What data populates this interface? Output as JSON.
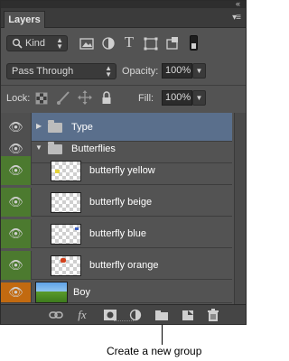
{
  "panel": {
    "tab_label": "Layers",
    "collapse_icon": "double-chevron-icon",
    "menu_icon": "panel-menu-icon"
  },
  "filter": {
    "kind_label": "Kind",
    "icons": [
      "pixel-layer-filter-icon",
      "adjustment-filter-icon",
      "type-filter-icon",
      "shape-filter-icon",
      "smart-object-filter-icon",
      "filter-toggle-icon"
    ]
  },
  "blend": {
    "mode": "Pass Through",
    "opacity_label": "Opacity:",
    "opacity_value": "100%"
  },
  "lock": {
    "label": "Lock:",
    "icons": [
      "lock-transparent-icon",
      "lock-image-icon",
      "lock-position-icon",
      "lock-all-icon"
    ],
    "fill_label": "Fill:",
    "fill_value": "100%"
  },
  "layers": [
    {
      "name": "Type",
      "kind": "group",
      "expanded": false,
      "visible": true,
      "selected": true
    },
    {
      "name": "Butterflies",
      "kind": "group",
      "expanded": true,
      "visible": true,
      "selected": false
    },
    {
      "name": "butterfly yellow",
      "kind": "layer",
      "eye_color": "#4c7a2f",
      "indent": true
    },
    {
      "name": "butterfly beige",
      "kind": "layer",
      "eye_color": "#4c7a2f",
      "indent": true
    },
    {
      "name": "butterfly blue",
      "kind": "layer",
      "eye_color": "#4c7a2f",
      "indent": true
    },
    {
      "name": "butterfly orange",
      "kind": "layer",
      "eye_color": "#4c7a2f",
      "indent": true
    },
    {
      "name": "Boy",
      "kind": "layer",
      "eye_color": "#c26a10",
      "indent": false
    }
  ],
  "bottom_icons": [
    "link-layers-icon",
    "fx-icon",
    "add-mask-icon",
    "adjustment-layer-icon",
    "new-group-icon",
    "new-layer-icon",
    "trash-icon"
  ],
  "fx_label": "fx",
  "callout": {
    "text": "Create a new group"
  },
  "colors": {
    "panel_bg": "#535353",
    "selected_row": "#5a6f8c",
    "eye_green": "#4c7a2f",
    "eye_orange": "#c26a10"
  }
}
